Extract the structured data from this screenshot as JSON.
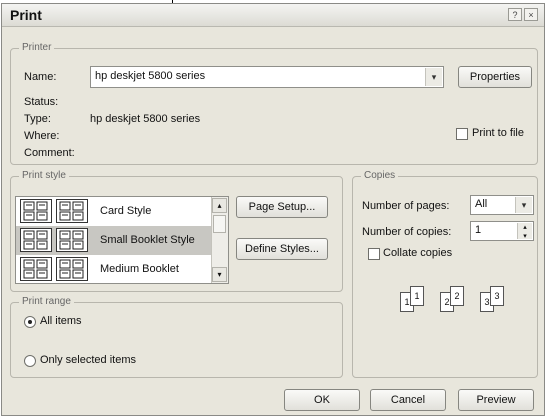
{
  "window": {
    "title": "Print",
    "help_glyph": "?",
    "close_glyph": "×"
  },
  "printer": {
    "group_label": "Printer",
    "name_label": "Name:",
    "name_value": "hp deskjet 5800 series",
    "properties_label": "Properties",
    "status_label": "Status:",
    "type_label": "Type:",
    "type_value": "hp deskjet 5800 series",
    "where_label": "Where:",
    "comment_label": "Comment:",
    "print_to_file_label": "Print to file",
    "print_to_file_checked": false
  },
  "print_style": {
    "group_label": "Print style",
    "items": [
      {
        "label": "Card Style",
        "selected": false
      },
      {
        "label": "Small Booklet Style",
        "selected": true
      },
      {
        "label": "Medium Booklet",
        "selected": false
      }
    ],
    "page_setup_label": "Page Setup...",
    "define_styles_label": "Define Styles..."
  },
  "copies": {
    "group_label": "Copies",
    "pages_label": "Number of pages:",
    "pages_value": "All",
    "copies_label": "Number of copies:",
    "copies_value": "1",
    "collate_label": "Collate copies",
    "collate_checked": false,
    "page_numbers": [
      "1",
      "1",
      "2",
      "2",
      "3",
      "3"
    ]
  },
  "print_range": {
    "group_label": "Print range",
    "all_items_label": "All items",
    "selected_items_label": "Only selected items",
    "selected": "all"
  },
  "footer": {
    "ok_label": "OK",
    "cancel_label": "Cancel",
    "preview_label": "Preview"
  },
  "icons": {
    "dropdown": "▾",
    "scroll_up": "▴",
    "scroll_down": "▾",
    "spin_up": "▴",
    "spin_down": "▾"
  }
}
